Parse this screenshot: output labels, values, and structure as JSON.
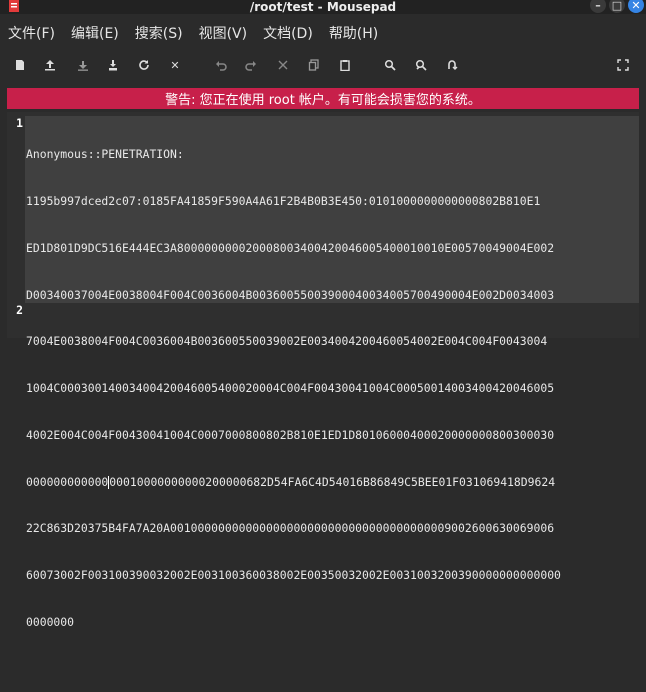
{
  "window": {
    "title": "/root/test - Mousepad"
  },
  "menu": [
    "文件(F)",
    "编辑(E)",
    "搜索(S)",
    "视图(V)",
    "文档(D)",
    "帮助(H)"
  ],
  "toolbar": {
    "icons": [
      "new-document-icon",
      "open-icon",
      "save-icon",
      "save-as-icon",
      "reload-icon",
      "close-doc-icon",
      "undo-icon",
      "redo-icon",
      "cut-icon",
      "copy-icon",
      "paste-icon",
      "find-icon",
      "find-replace-icon",
      "goto-icon",
      "fullscreen-icon"
    ]
  },
  "warning": "警告: 您正在使用 root 帐户。有可能会损害您的系统。",
  "editor": {
    "line_numbers": [
      "1",
      "",
      "",
      "",
      "",
      "",
      "",
      "",
      "",
      "",
      "",
      "",
      "2"
    ],
    "lines": [
      "Anonymous::PENETRATION:",
      "1195b997dced2c07:0185FA41859F590A4A61F2B4B0B3E450:0101000000000000802B810E1",
      "ED1D801D9DC516E444EC3A800000000020008003400420046005400010010E00570049004E002",
      "D00340037004E0038004F004C0036004B00360055003900040034005700490004E002D0034003",
      "7004E0038004F004C0036004B003600550039002E0034004200460054002E004C004F0043004",
      "1004C00030014003400420046005400020004C004F00430041004C00050014003400420046005",
      "4002E004C004F00430041004C0007000800802B810E1ED1D80106000400020000000800300030",
      "000000000000",
      "00010000000000200000682D54FA6C4D54016B86849C5BEE01F031069418D9624",
      "22C863D20375B4FA7A20A00100000000000000000000000000000000000009002600630069006",
      "60073002F003100390032002E003100360038002E00350032002E0031003200390000000000000",
      "0000000",
      ""
    ]
  }
}
